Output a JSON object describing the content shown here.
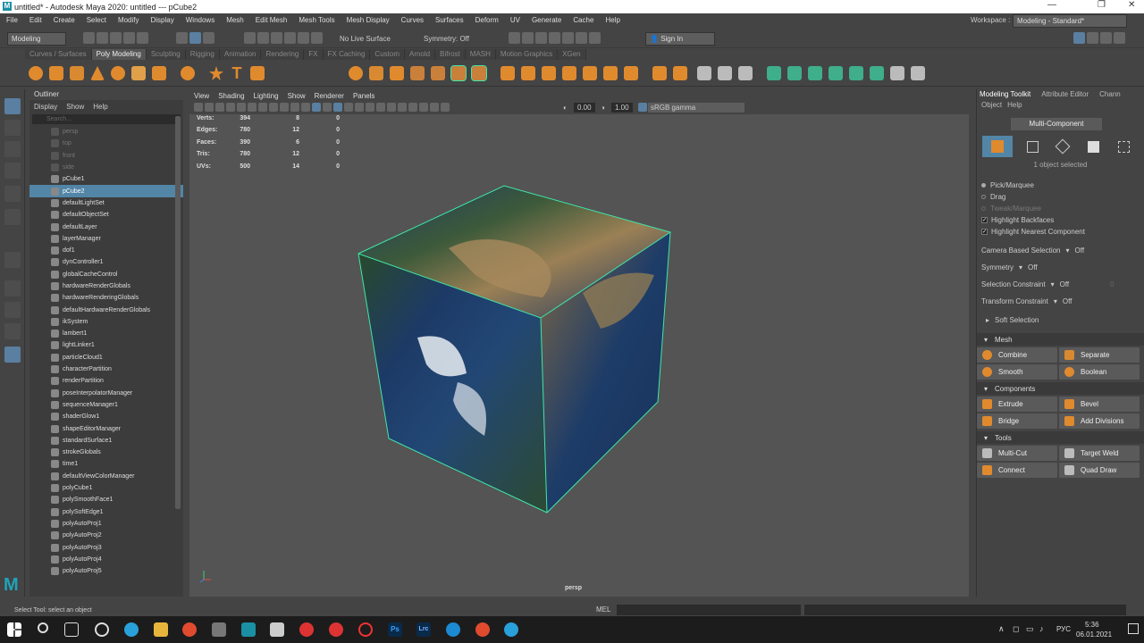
{
  "window": {
    "title": "untitled* - Autodesk Maya 2020: untitled   ---   pCube2",
    "logo": "M",
    "controls": [
      "—",
      "❐",
      "✕"
    ]
  },
  "menubar": [
    "File",
    "Edit",
    "Create",
    "Select",
    "Modify",
    "Display",
    "Windows",
    "Mesh",
    "Edit Mesh",
    "Mesh Tools",
    "Mesh Display",
    "Curves",
    "Surfaces",
    "Deform",
    "UV",
    "Generate",
    "Cache",
    "Help"
  ],
  "statusline": {
    "mode": "Modeling",
    "live_surface": "No Live Surface",
    "symmetry": "Symmetry: Off",
    "sign_in": "Sign In",
    "workspace_label": "Workspace :",
    "workspace": "Modeling - Standard*"
  },
  "shelf_tabs": [
    "Curves / Surfaces",
    "Poly Modeling",
    "Sculpting",
    "Rigging",
    "Animation",
    "Rendering",
    "FX",
    "FX Caching",
    "Custom",
    "Arnold",
    "Bifrost",
    "MASH",
    "Motion Graphics",
    "XGen"
  ],
  "shelf_active": "Poly Modeling",
  "outliner": {
    "title": "Outliner",
    "menu": [
      "Display",
      "Show",
      "Help"
    ],
    "search_placeholder": "Search...",
    "items": [
      {
        "label": "persp",
        "dim": true
      },
      {
        "label": "top",
        "dim": true
      },
      {
        "label": "front",
        "dim": true
      },
      {
        "label": "side",
        "dim": true
      },
      {
        "label": "pCube1"
      },
      {
        "label": "pCube2",
        "selected": true
      },
      {
        "label": "defaultLightSet"
      },
      {
        "label": "defaultObjectSet"
      },
      {
        "label": "defaultLayer"
      },
      {
        "label": "layerManager"
      },
      {
        "label": "dof1"
      },
      {
        "label": "dynController1"
      },
      {
        "label": "globalCacheControl"
      },
      {
        "label": "hardwareRenderGlobals"
      },
      {
        "label": "hardwareRenderingGlobals"
      },
      {
        "label": "defaultHardwareRenderGlobals"
      },
      {
        "label": "ikSystem"
      },
      {
        "label": "lambert1"
      },
      {
        "label": "lightLinker1"
      },
      {
        "label": "particleCloud1"
      },
      {
        "label": "characterPartition"
      },
      {
        "label": "renderPartition"
      },
      {
        "label": "poseInterpolatorManager"
      },
      {
        "label": "sequenceManager1"
      },
      {
        "label": "shaderGlow1"
      },
      {
        "label": "shapeEditorManager"
      },
      {
        "label": "standardSurface1"
      },
      {
        "label": "strokeGlobals"
      },
      {
        "label": "time1"
      },
      {
        "label": "defaultViewColorManager"
      },
      {
        "label": "polyCube1"
      },
      {
        "label": "polySmoothFace1"
      },
      {
        "label": "polySoftEdge1"
      },
      {
        "label": "polyAutoProj1"
      },
      {
        "label": "polyAutoProj2"
      },
      {
        "label": "polyAutoProj3"
      },
      {
        "label": "polyAutoProj4"
      },
      {
        "label": "polyAutoProj5"
      }
    ]
  },
  "viewport": {
    "menu": [
      "View",
      "Shading",
      "Lighting",
      "Show",
      "Renderer",
      "Panels"
    ],
    "exposure": "0.00",
    "gamma": "1.00",
    "colorspace": "sRGB gamma",
    "camera": "persp",
    "hud": [
      {
        "label": "Verts:",
        "a": "394",
        "b": "8",
        "c": "0"
      },
      {
        "label": "Edges:",
        "a": "780",
        "b": "12",
        "c": "0"
      },
      {
        "label": "Faces:",
        "a": "390",
        "b": "6",
        "c": "0"
      },
      {
        "label": "Tris:",
        "a": "780",
        "b": "12",
        "c": "0"
      },
      {
        "label": "UVs:",
        "a": "500",
        "b": "14",
        "c": "0"
      }
    ]
  },
  "toolkit": {
    "tabs": [
      "Modeling Toolkit",
      "Attribute Editor",
      "Chann"
    ],
    "menu": [
      "Object",
      "Help"
    ],
    "mode": "Multi-Component",
    "selected_info": "1 object selected",
    "pick": "Pick/Marquee",
    "drag": "Drag",
    "tweak": "Tweak/Marquee",
    "highlight_backfaces": "Highlight Backfaces",
    "highlight_nearest": "Highlight Nearest Component",
    "camera_sel": "Camera Based Selection",
    "camera_sel_val": "Off",
    "symmetry": "Symmetry",
    "symmetry_val": "Off",
    "sel_constraint": "Selection Constraint",
    "sel_constraint_val": "Off",
    "sel_constraint_num": "0",
    "transform_constraint": "Transform Constraint",
    "transform_constraint_val": "Off",
    "soft_selection": "Soft Selection",
    "sections": {
      "mesh": "Mesh",
      "components": "Components",
      "tools": "Tools"
    },
    "mesh_buttons": [
      "Combine",
      "Separate",
      "Smooth",
      "Boolean"
    ],
    "component_buttons": [
      "Extrude",
      "Bevel",
      "Bridge",
      "Add Divisions"
    ],
    "tool_buttons": [
      "Multi-Cut",
      "Target Weld",
      "Connect",
      "Quad Draw"
    ]
  },
  "helpline": {
    "text": "Select Tool: select an object",
    "cmd_type": "MEL"
  },
  "taskbar": {
    "lang": "РУС",
    "time": "5:36",
    "date": "06.01.2021"
  },
  "colors": {
    "selection": "#5285a6",
    "wireframe": "#3fe6a8",
    "accent_orange": "#e08a2e"
  }
}
